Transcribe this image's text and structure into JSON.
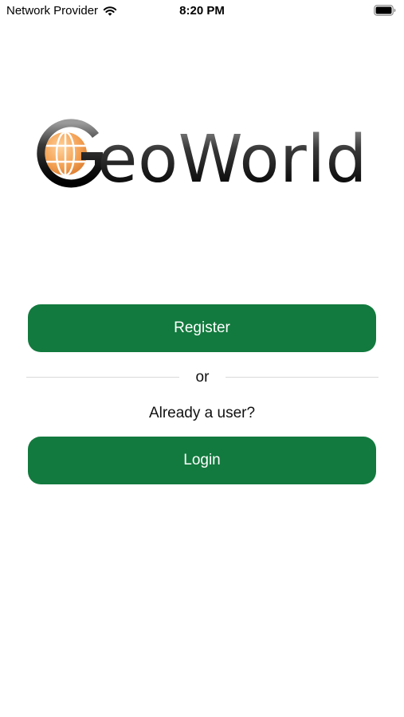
{
  "status_bar": {
    "carrier": "Network Provider",
    "time": "8:20 PM",
    "wifi_icon": "wifi-icon",
    "battery_icon": "battery-icon"
  },
  "logo": {
    "text": "GeoWorld",
    "icon": "globe-icon",
    "globe_color": "#f0a050"
  },
  "actions": {
    "register_label": "Register",
    "divider_text": "or",
    "already_user_text": "Already a user?",
    "login_label": "Login"
  },
  "colors": {
    "button_background": "#127a3e",
    "button_text": "#ffffff",
    "divider": "#d9d9d9",
    "background": "#ffffff"
  }
}
